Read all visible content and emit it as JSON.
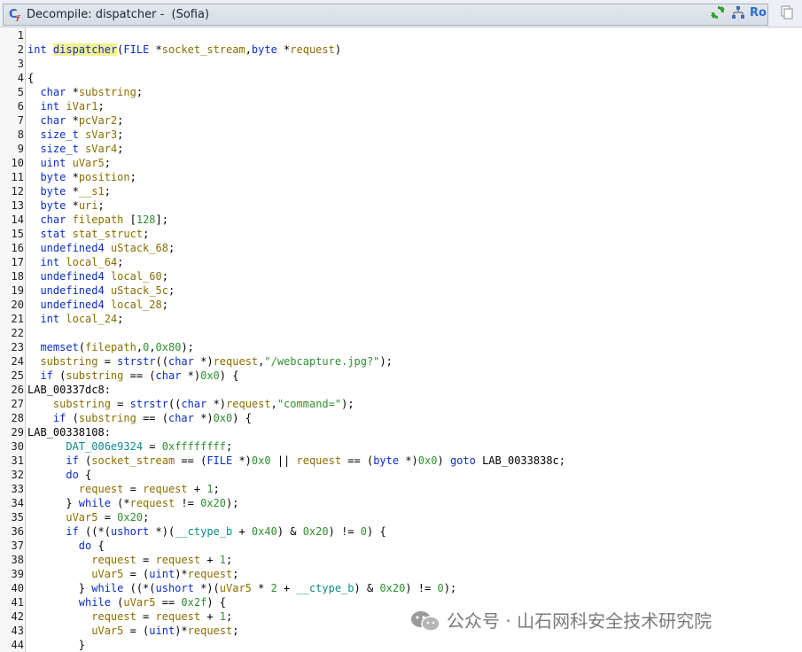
{
  "window": {
    "title": "Decompile: dispatcher -  (Sofia)",
    "toolbar": {
      "refresh_icon": "refresh-icon",
      "tree_icon": "function-graph-icon",
      "ro_label": "Ro",
      "copy_icon": "copy-icon"
    }
  },
  "code": {
    "lines": [
      {
        "n": "1",
        "text": ""
      },
      {
        "n": "2",
        "text": "int dispatcher(FILE *socket_stream,byte *request)"
      },
      {
        "n": "3",
        "text": ""
      },
      {
        "n": "4",
        "text": "{"
      },
      {
        "n": "5",
        "text": "  char *substring;"
      },
      {
        "n": "6",
        "text": "  int iVar1;"
      },
      {
        "n": "7",
        "text": "  char *pcVar2;"
      },
      {
        "n": "8",
        "text": "  size_t sVar3;"
      },
      {
        "n": "9",
        "text": "  size_t sVar4;"
      },
      {
        "n": "10",
        "text": "  uint uVar5;"
      },
      {
        "n": "11",
        "text": "  byte *position;"
      },
      {
        "n": "12",
        "text": "  byte *__s1;"
      },
      {
        "n": "13",
        "text": "  byte *uri;"
      },
      {
        "n": "14",
        "text": "  char filepath [128];"
      },
      {
        "n": "15",
        "text": "  stat stat_struct;"
      },
      {
        "n": "16",
        "text": "  undefined4 uStack_68;"
      },
      {
        "n": "17",
        "text": "  int local_64;"
      },
      {
        "n": "18",
        "text": "  undefined4 local_60;"
      },
      {
        "n": "19",
        "text": "  undefined4 uStack_5c;"
      },
      {
        "n": "20",
        "text": "  undefined4 local_28;"
      },
      {
        "n": "21",
        "text": "  int local_24;"
      },
      {
        "n": "22",
        "text": "  "
      },
      {
        "n": "23",
        "text": "  memset(filepath,0,0x80);"
      },
      {
        "n": "24",
        "text": "  substring = strstr((char *)request,\"/webcapture.jpg?\");"
      },
      {
        "n": "25",
        "text": "  if (substring == (char *)0x0) {"
      },
      {
        "n": "26",
        "text": "LAB_00337dc8:"
      },
      {
        "n": "27",
        "text": "    substring = strstr((char *)request,\"command=\");"
      },
      {
        "n": "28",
        "text": "    if (substring == (char *)0x0) {"
      },
      {
        "n": "29",
        "text": "LAB_00338108:"
      },
      {
        "n": "30",
        "text": "      DAT_006e9324 = 0xffffffff;"
      },
      {
        "n": "31",
        "text": "      if (socket_stream == (FILE *)0x0 || request == (byte *)0x0) goto LAB_0033838c;"
      },
      {
        "n": "32",
        "text": "      do {"
      },
      {
        "n": "33",
        "text": "        request = request + 1;"
      },
      {
        "n": "34",
        "text": "      } while (*request != 0x20);"
      },
      {
        "n": "35",
        "text": "      uVar5 = 0x20;"
      },
      {
        "n": "36",
        "text": "      if ((*(ushort *)(__ctype_b + 0x40) & 0x20) != 0) {"
      },
      {
        "n": "37",
        "text": "        do {"
      },
      {
        "n": "38",
        "text": "          request = request + 1;"
      },
      {
        "n": "39",
        "text": "          uVar5 = (uint)*request;"
      },
      {
        "n": "40",
        "text": "        } while ((*(ushort *)(uVar5 * 2 + __ctype_b) & 0x20) != 0);"
      },
      {
        "n": "41",
        "text": "        while (uVar5 == 0x2f) {"
      },
      {
        "n": "42",
        "text": "          request = request + 1;"
      },
      {
        "n": "43",
        "text": "          uVar5 = (uint)*request;"
      },
      {
        "n": "44",
        "text": "        }"
      }
    ]
  },
  "watermark": {
    "text": "公众号 · 山石网科安全技术研究院",
    "icon": "wechat-icon"
  },
  "colors": {
    "keyword": "#0a2dc8",
    "type": "#0a2dc8",
    "variable": "#8a6d00",
    "param": "#8a6d00",
    "function": "#0a2dc8",
    "global": "#0c8a8a",
    "constant": "#2f8f2f",
    "string": "#2f8f2f",
    "highlight": "#f5f08a"
  }
}
